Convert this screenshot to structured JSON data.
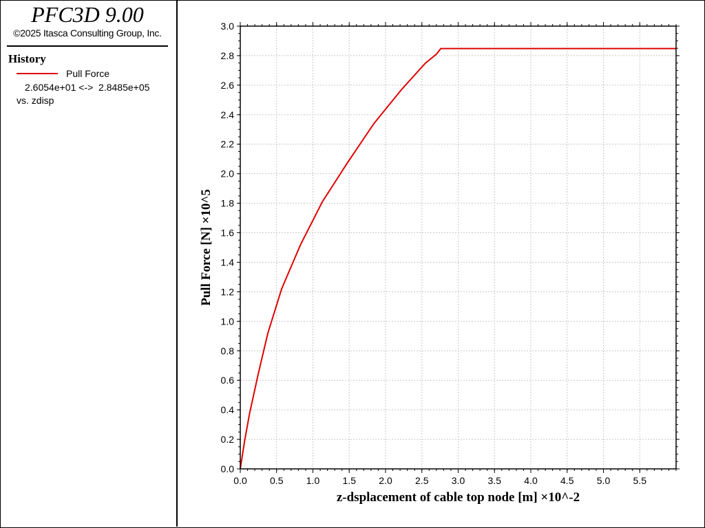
{
  "app": {
    "title": "PFC3D 9.00",
    "copyright": "©2025 Itasca Consulting Group, Inc."
  },
  "legend": {
    "section_title": "History",
    "series_name": "Pull Force",
    "series_color": "#e00000",
    "range": "2.6054e+01 <->  2.8485e+05",
    "vs_label": "vs. zdisp"
  },
  "chart_data": {
    "type": "line",
    "xlabel": "z-dsplacement of cable top node [m]",
    "xscale_label": "×10^-2",
    "ylabel": "Pull Force [N]",
    "yscale_label": "×10^5",
    "xlim": [
      0,
      6.0
    ],
    "ylim": [
      0,
      3.0
    ],
    "x_ticks": [
      "0.0",
      "0.5",
      "1.0",
      "1.5",
      "2.0",
      "2.5",
      "3.0",
      "3.5",
      "4.0",
      "4.5",
      "5.0",
      "5.5"
    ],
    "y_ticks": [
      "0.0",
      "0.2",
      "0.4",
      "0.6",
      "0.8",
      "1.0",
      "1.2",
      "1.4",
      "1.6",
      "1.8",
      "2.0",
      "2.2",
      "2.4",
      "2.6",
      "2.8",
      "3.0"
    ],
    "grid": true,
    "series": [
      {
        "name": "Pull Force",
        "color": "#e00000",
        "x": [
          0.0,
          0.06,
          0.13,
          0.25,
          0.38,
          0.57,
          0.83,
          1.13,
          1.47,
          1.84,
          2.22,
          2.55,
          2.7,
          2.76,
          3.5,
          4.5,
          5.5,
          6.0
        ],
        "y": [
          0.0,
          0.19,
          0.38,
          0.65,
          0.92,
          1.22,
          1.52,
          1.81,
          2.07,
          2.34,
          2.57,
          2.75,
          2.81,
          2.848,
          2.848,
          2.848,
          2.848,
          2.848
        ]
      }
    ]
  }
}
